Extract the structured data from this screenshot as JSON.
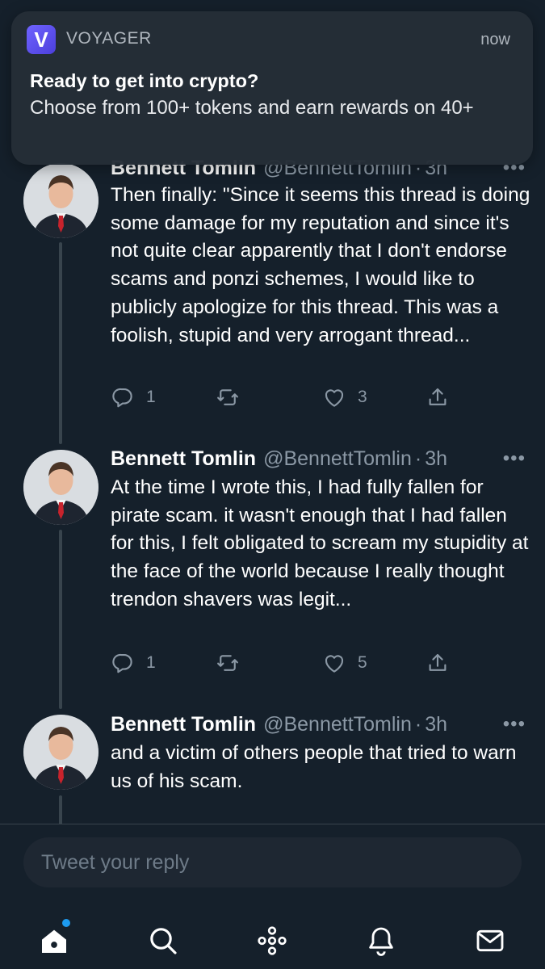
{
  "notification": {
    "app_name": "VOYAGER",
    "logo_letter": "V",
    "time": "now",
    "title": "Ready to get into crypto?",
    "body": "Choose from 100+ tokens and earn rewards on 40+"
  },
  "tweets": [
    {
      "name": "Bennett Tomlin",
      "handle": "@BennettTomlin",
      "dot": "·",
      "time": "3h",
      "more": "•••",
      "text": "Then finally: \"Since it seems this thread is doing some damage for my reputation and since it's not quite clear apparently that I don't endorse scams and ponzi schemes, I would like to publicly apologize for this thread. This was a foolish, stupid and very arrogant thread...",
      "replies": "1",
      "retweets": "",
      "likes": "3"
    },
    {
      "name": "Bennett Tomlin",
      "handle": "@BennettTomlin",
      "dot": "·",
      "time": "3h",
      "more": "•••",
      "text": "At the time I wrote this, I had fully fallen for pirate scam. it wasn't enough that I had fallen for this, I felt obligated to scream my stupidity at the face of the world because I really thought trendon shavers was legit...",
      "replies": "1",
      "retweets": "",
      "likes": "5"
    },
    {
      "name": "Bennett Tomlin",
      "handle": "@BennettTomlin",
      "dot": "·",
      "time": "3h",
      "more": "•••",
      "text": "and a victim of others people that tried to warn us of his scam."
    }
  ],
  "reply": {
    "placeholder": "Tweet your reply"
  },
  "nav": {
    "items": [
      "home-icon",
      "search-icon",
      "spaces-icon",
      "notifications-icon",
      "messages-icon"
    ],
    "active": "home-icon",
    "unread_indicator": true
  },
  "colors": {
    "background": "#15202b",
    "secondary_text": "#8b98a5",
    "accent": "#1d9bf0",
    "voyager_brand": "#5b4ff0",
    "like_brand": "#ffffff"
  }
}
